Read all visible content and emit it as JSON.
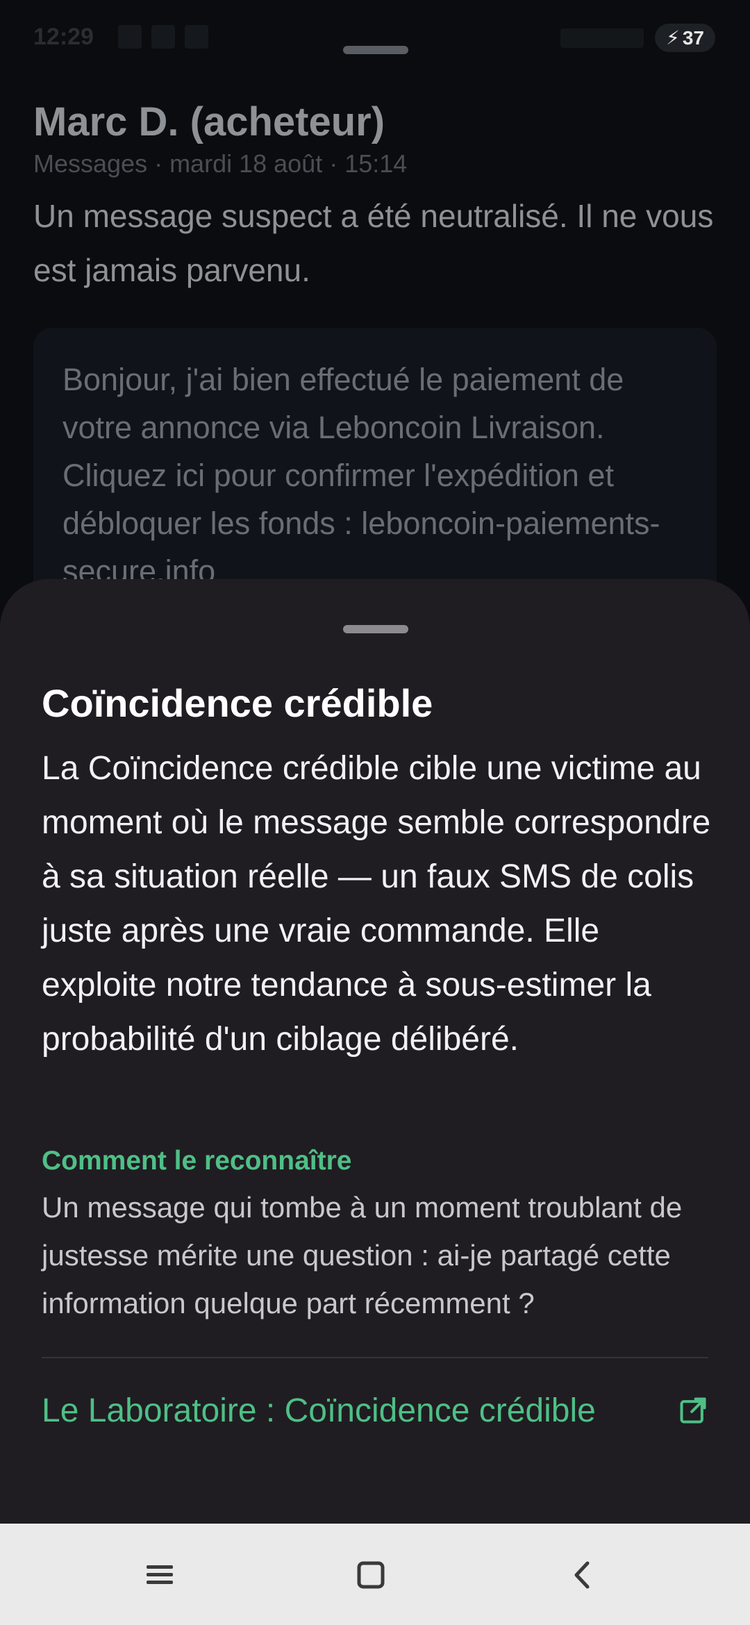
{
  "status_bar": {
    "time": "12:29",
    "battery": "37"
  },
  "conversation": {
    "sender": "Marc D. (acheteur)",
    "meta": "Messages · mardi 18 août · 15:14",
    "notice": "Un message suspect a été neutralisé. Il ne vous est jamais parvenu.",
    "message_excerpt": "Bonjour, j'ai bien effectué le paiement de votre annonce via Leboncoin Livraison. Cliquez ici pour confirmer l'expédition et débloquer les fonds : leboncoin-paiements-secure.info"
  },
  "sheet": {
    "title": "Coïncidence crédible",
    "description": "La Coïncidence crédible cible une victime au moment où le message semble correspondre à sa situation réelle — un faux SMS de colis juste après une vraie commande. Elle exploite notre tendance à sous-estimer la probabilité d'un ciblage délibéré.",
    "recognize_label": "Comment le reconnaître",
    "recognize_text": "Un message qui tombe à un moment troublant de justesse mérite une question : ai-je partagé cette information quelque part récemment ?",
    "link_label": "Le Laboratoire : Coïncidence crédible",
    "link_icon": "external-link-icon"
  },
  "colors": {
    "accent": "#4fbf86",
    "sheet_bg": "#1f1d22",
    "page_bg": "#0a0c0f"
  },
  "nav_bar": {
    "icons": [
      "menu-icon",
      "home-square-icon",
      "back-chevron-icon"
    ]
  }
}
